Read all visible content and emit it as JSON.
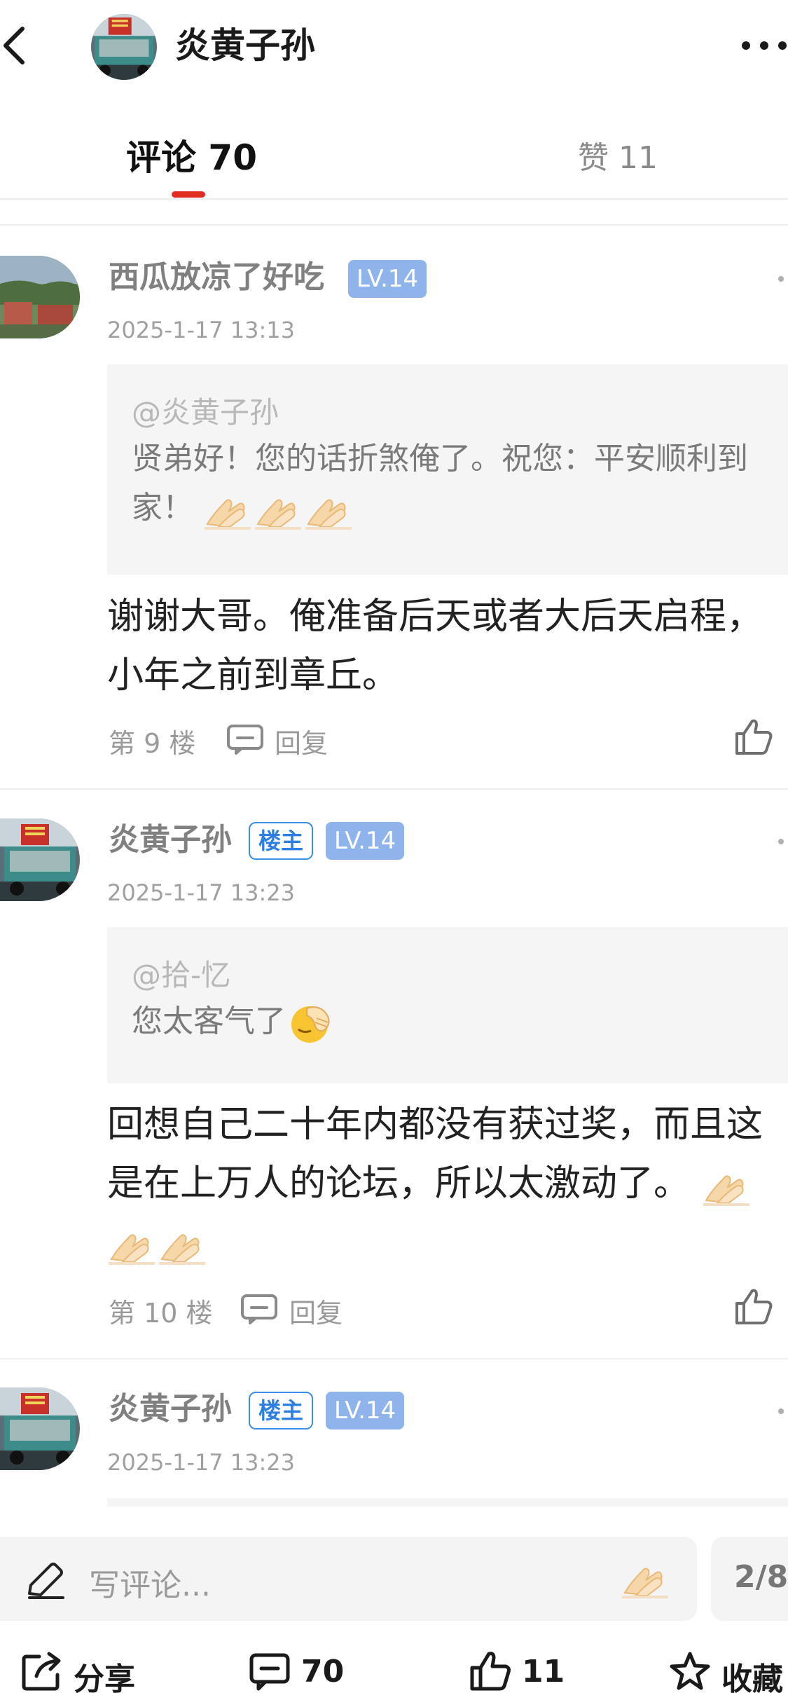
{
  "header": {
    "title": "炎黄子孙",
    "avatar_icon": "truck-photo-avatar",
    "back_icon": "chevron-left-icon",
    "more_icon": "more-dots-icon"
  },
  "tabs": {
    "comments": "评论 70",
    "likes": "赞 11"
  },
  "comments": [
    {
      "name": "西瓜放凉了好吃",
      "level": "LV.14",
      "time": "2025-1-17 13:13",
      "quote_user": "@炎黄子孙",
      "quote_text": "贤弟好！您的话折煞俺了。祝您：平安顺利到家！",
      "quote_emojis": [
        "folded-hands",
        "folded-hands",
        "folded-hands"
      ],
      "body": "谢谢大哥。俺准备后天或者大后天启程，小年之前到章丘。",
      "floor": "第 9 楼",
      "reply": "回复"
    },
    {
      "name": "炎黄子孙",
      "owner_badge": "楼主",
      "level": "LV.14",
      "time": "2025-1-17 13:23",
      "quote_user": "@拾-忆",
      "quote_text": "您太客气了",
      "quote_emojis": [
        "facepalm"
      ],
      "body": "回想自己二十年内都没有获过奖，而且这是在上万人的论坛，所以太激动了。",
      "body_emojis": [
        "folded-hands",
        "folded-hands",
        "folded-hands"
      ],
      "floor": "第 10 楼",
      "reply": "回复"
    },
    {
      "name": "炎黄子孙",
      "owner_badge": "楼主",
      "level": "LV.14",
      "time": "2025-1-17 13:23"
    }
  ],
  "input": {
    "placeholder": "写评论...",
    "page": "2/8"
  },
  "bottom_bar": {
    "share": "分享",
    "comments": "70",
    "likes": "11",
    "favorite": "收藏"
  },
  "colors": {
    "accent_red": "#e02e24",
    "owner_blue": "#3b8fe8",
    "level_bg": "#8fb4ec"
  }
}
